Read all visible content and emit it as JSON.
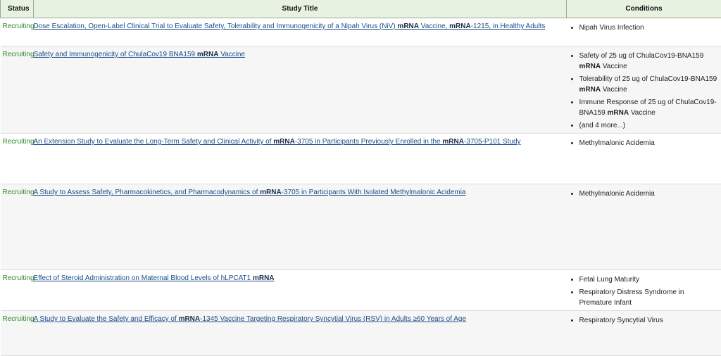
{
  "headers": {
    "status": "Status",
    "title": "Study Title",
    "conditions": "Conditions"
  },
  "rows": [
    {
      "status": "Recruiting",
      "title": [
        "Dose Escalation, Open-Label Clinical Trial to Evaluate Safety, Tolerability and Immunogenicity of a Nipah Virus (NiV) ",
        "mRNA",
        " Vaccine, ",
        "mRNA",
        "-1215, in Healthy Adults"
      ],
      "conditions": [
        [
          "Nipah Virus Infection"
        ]
      ]
    },
    {
      "status": "Recruiting",
      "title": [
        "Safety and Immunogenicity of ChulaCov19 BNA159 ",
        "mRNA",
        " Vaccine"
      ],
      "conditions": [
        [
          "Safety of 25 ug of ChulaCov19-BNA159 ",
          "mRNA",
          " Vaccine"
        ],
        [
          "Tolerability of 25 ug of ChulaCov19-BNA159 ",
          "mRNA",
          " Vaccine"
        ],
        [
          "Immune Response of 25 ug of ChulaCov19-BNA159 ",
          "mRNA",
          " Vaccine"
        ],
        [
          "(and 4 more...)"
        ]
      ]
    },
    {
      "status": "Recruiting",
      "title": [
        "An Extension Study to Evaluate the Long-Term Safety and Clinical Activity of ",
        "mRNA",
        "-3705 in Participants Previously Enrolled in the ",
        "mRNA",
        "-3705-P101 Study"
      ],
      "conditions": [
        [
          "Methylmalonic Acidemia"
        ]
      ]
    },
    {
      "status": "Recruiting",
      "title": [
        "A Study to Assess Safety, Pharmacokinetics, and Pharmacodynamics of ",
        "mRNA",
        "-3705 in Participants With Isolated Methylmalonic Acidemia"
      ],
      "conditions": [
        [
          "Methylmalonic Acidemia"
        ]
      ]
    },
    {
      "status": "Recruiting",
      "title": [
        "Effect of Steroid Administration on Maternal Blood Levels of hLPCAT1 ",
        "mRNA"
      ],
      "conditions": [
        [
          "Fetal Lung Maturity"
        ],
        [
          "Respiratory Distress Syndrome in Premature Infant"
        ]
      ]
    },
    {
      "status": "Recruiting",
      "title": [
        "A Study to Evaluate the Safety and Efficacy of ",
        "mRNA",
        "-1345 Vaccine Targeting Respiratory Syncytial Virus (RSV) in Adults ≥60 Years of Age"
      ],
      "conditions": [
        [
          "Respiratory Syncytial Virus"
        ]
      ]
    }
  ]
}
